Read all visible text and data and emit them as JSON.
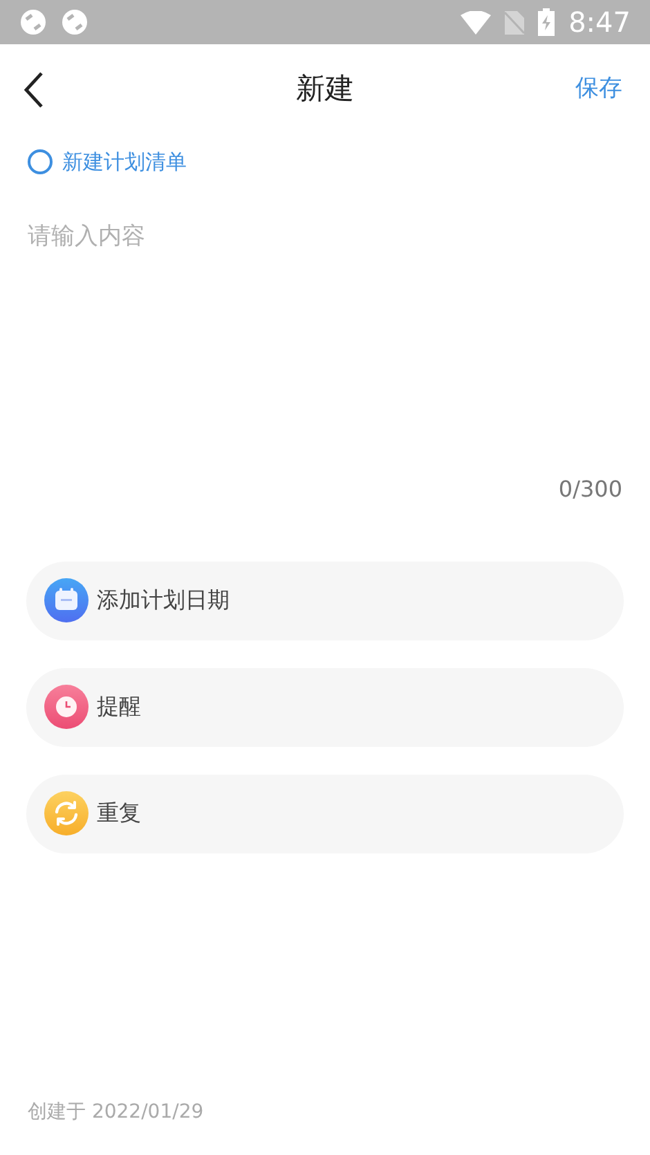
{
  "status_bar": {
    "time": "8:47"
  },
  "header": {
    "title": "新建",
    "action": "保存"
  },
  "plan_list": {
    "label": "新建计划清单",
    "checked": false
  },
  "editor": {
    "placeholder": "请输入内容",
    "counter": "0/300"
  },
  "options": [
    {
      "kind": "date",
      "label": "添加计划日期"
    },
    {
      "kind": "alarm",
      "label": "提醒"
    },
    {
      "kind": "repeat",
      "label": "重复"
    }
  ],
  "footer": {
    "created": "创建于 2022/01/29"
  }
}
